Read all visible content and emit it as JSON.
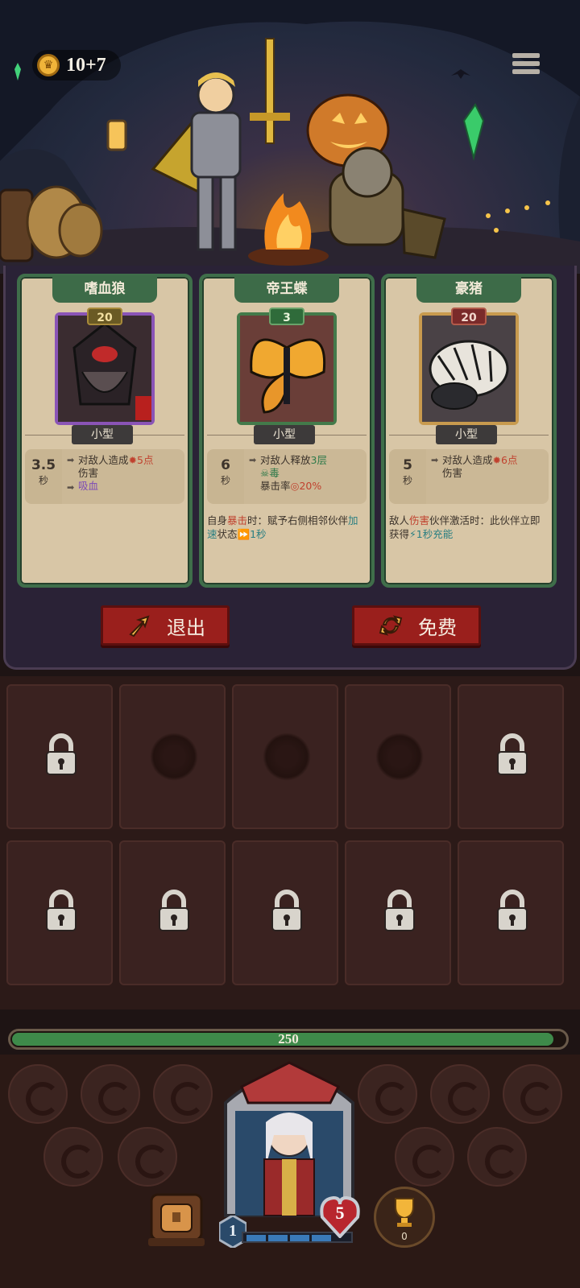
{
  "hud": {
    "coins": "10+7",
    "coin_icon": "crown-coin-icon",
    "menu_icon": "hamburger-menu-icon"
  },
  "shop": {
    "cards": [
      {
        "name": "嗜血狼",
        "level": "20",
        "type": "小型",
        "cooldown": "3.5",
        "cooldown_unit": "秒",
        "effect_prefix": "对敌人造成",
        "effect_value": "5点",
        "effect_suffix": "伤害",
        "effect_tag": "吸血",
        "frame_color": "#8a54b6"
      },
      {
        "name": "帝王蝶",
        "level": "3",
        "type": "小型",
        "cooldown": "6",
        "cooldown_unit": "秒",
        "effect_prefix": "对敌人释放",
        "effect_value": "3层",
        "effect_status": "毒",
        "crit_label": "暴击率",
        "crit_value": "20%",
        "extra_pre": "自身",
        "extra_kw": "暴击",
        "extra_mid": "时：赋予右侧相邻伙伴",
        "extra_kw2": "加速",
        "extra_post": "状态",
        "extra_time": "1秒",
        "frame_color": "#437a4a"
      },
      {
        "name": "豪猪",
        "level": "20",
        "type": "小型",
        "cooldown": "5",
        "cooldown_unit": "秒",
        "effect_prefix": "对敌人造成",
        "effect_value": "6点",
        "effect_suffix": "伤害",
        "extra_pre": "敌人",
        "extra_kw": "伤害",
        "extra_mid": "伙伴激活时：此伙伴立即获得",
        "extra_time": "1秒",
        "extra_kw2": "充能",
        "frame_color": "#c89a4e"
      }
    ],
    "exit_label": "退出",
    "refresh_label": "免费"
  },
  "player": {
    "hp": "250",
    "hp_fraction": 0.98,
    "level": "1",
    "armor": "5",
    "trophies": "0",
    "xp_segments_filled": 4,
    "xp_segments_total": 5
  },
  "colors": {
    "accent_red": "#9a1f1c",
    "card_green": "#3d6b48",
    "hp_green": "#3e8a4a"
  }
}
